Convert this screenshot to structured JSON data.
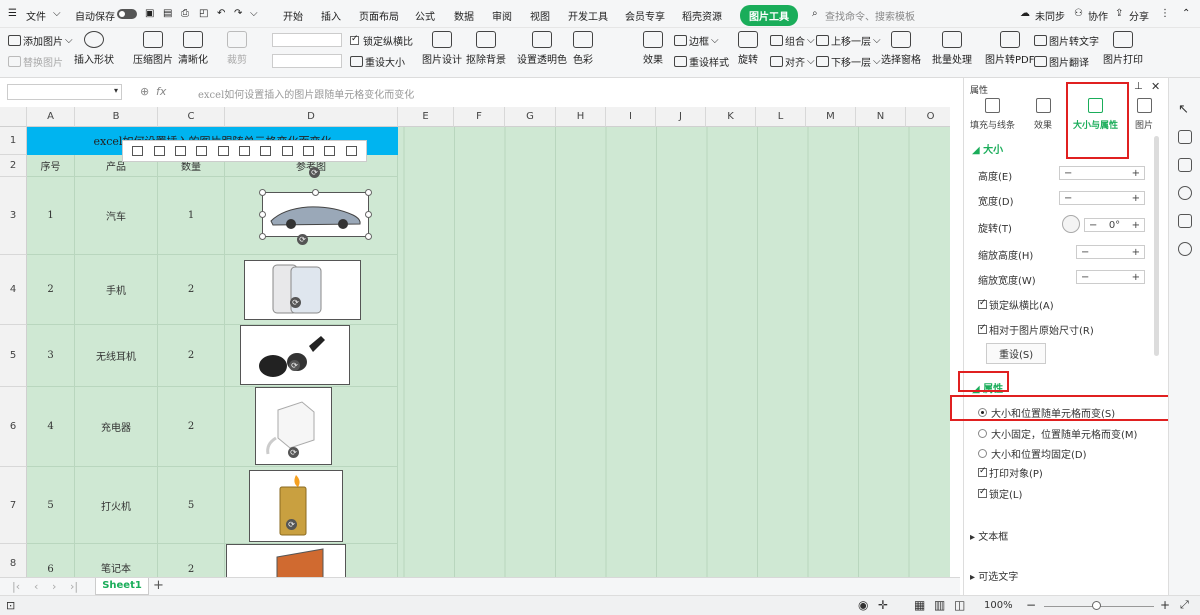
{
  "menubar": {
    "file": "文件",
    "autosave": "自动保存",
    "tabs": [
      "开始",
      "插入",
      "页面布局",
      "公式",
      "数据",
      "审阅",
      "视图",
      "开发工具",
      "会员专享",
      "稻壳资源"
    ],
    "active_tab": "图片工具",
    "search": "查找命令、搜索模板",
    "sync": "未同步",
    "collab": "协作",
    "share": "分享"
  },
  "ribbon": {
    "add_image": "添加图片",
    "replace_image": "替换图片",
    "insert_shape": "插入形状",
    "compress": "压缩图片",
    "clarity": "清晰化",
    "crop": "裁剪",
    "lock_ratio": "锁定纵横比",
    "reset_size": "重设大小",
    "picture_design": "图片设计",
    "remove_bg": "抠除背景",
    "transparent": "设置透明色",
    "color": "色彩",
    "effect": "效果",
    "border": "边框",
    "reset_style": "重设样式",
    "rotate": "旋转",
    "group": "组合",
    "align": "对齐",
    "bring_forward": "上移一层",
    "send_backward": "下移一层",
    "selection_pane": "选择窗格",
    "batch": "批量处理",
    "to_pdf": "图片转PDF",
    "to_text": "图片转文字",
    "translate": "图片翻译",
    "print": "图片打印"
  },
  "formula_bar": {
    "fx": "fx",
    "content": "excel如何设置插入的图片跟随单元格变化而变化"
  },
  "sheet": {
    "columns": [
      "A",
      "B",
      "C",
      "D",
      "E",
      "F",
      "G",
      "H",
      "I",
      "J",
      "K",
      "L",
      "M",
      "N",
      "O"
    ],
    "row_numbers": [
      "1",
      "2",
      "3",
      "4",
      "5",
      "6",
      "7",
      "8"
    ],
    "title": "excel如何设置插入的图片跟随单元格变化而变化",
    "headers": [
      "序号",
      "产品",
      "数量",
      "参考图"
    ],
    "rows": [
      {
        "no": "1",
        "product": "汽车",
        "qty": "1"
      },
      {
        "no": "2",
        "product": "手机",
        "qty": "2"
      },
      {
        "no": "3",
        "product": "无线耳机",
        "qty": "2"
      },
      {
        "no": "4",
        "product": "充电器",
        "qty": "2"
      },
      {
        "no": "5",
        "product": "打火机",
        "qty": "5"
      },
      {
        "no": "6",
        "product": "笔记本",
        "qty": "2"
      }
    ],
    "tab": "Sheet1",
    "add_sheet": "+"
  },
  "panel": {
    "header": "属性",
    "tabs": [
      "填充与线条",
      "效果",
      "大小与属性",
      "图片"
    ],
    "section_size": "大小",
    "height": "高度(E)",
    "width": "宽度(D)",
    "rotation": "旋转(T)",
    "rotation_value": "0°",
    "scale_h": "缩放高度(H)",
    "scale_w": "缩放宽度(W)",
    "lock_ratio": "锁定纵横比(A)",
    "relative": "相对于图片原始尺寸(R)",
    "reset": "重设(S)",
    "section_props": "属性",
    "opt1": "大小和位置随单元格而变(S)",
    "opt2": "大小固定，位置随单元格而变(M)",
    "opt3": "大小和位置均固定(D)",
    "print_obj": "打印对象(P)",
    "locked": "锁定(L)",
    "textbox": "文本框",
    "alt_text": "可选文字"
  },
  "status": {
    "zoom": "100%"
  },
  "colors": {
    "accent": "#1aad5a",
    "grid_bg": "#cfe8d3",
    "title_bg": "#00b4f0",
    "highlight": "#e02020"
  }
}
